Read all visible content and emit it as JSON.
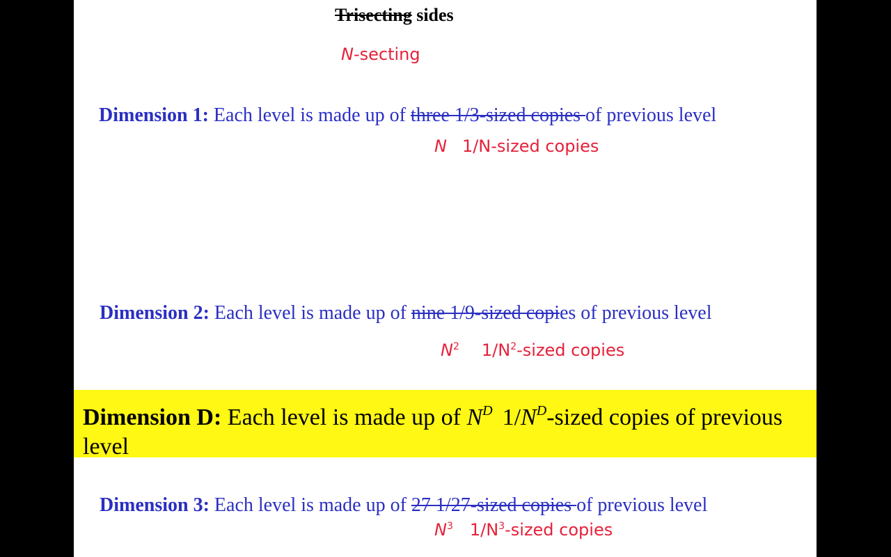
{
  "title": {
    "struck": "Trisecting",
    "rest": " sides"
  },
  "annotation_nsecting": {
    "n": "N",
    "rest": "-secting"
  },
  "dim1": {
    "label": "Dimension 1:",
    "lead": " Each level is made up of ",
    "struck": "three 1/3-sized copies ",
    "tail": "of previous level",
    "replacement_count": "N",
    "replacement_rest": "1/N-sized copies"
  },
  "dim2": {
    "label": "Dimension 2:",
    "lead": " Each level is made up of ",
    "struck": "nine 1/9-sized copi",
    "tail": "es of previous level",
    "replacement_count_base": "N",
    "replacement_count_exp": "2",
    "replacement_rest_a": "1/N",
    "replacement_rest_exp": "2",
    "replacement_rest_b": "-sized copies"
  },
  "dimD": {
    "label": "Dimension D:",
    "lead": " Each level is made up of ",
    "count_base": "N",
    "count_exp": "D",
    "frac_a": "1/",
    "frac_base": "N",
    "frac_exp": "D",
    "tail": "-sized copies of previous level",
    "highlight_color": "#fff714"
  },
  "dim3": {
    "label": "Dimension 3:",
    "lead": " Each level is made up of ",
    "struck": "27 1/27-sized copies ",
    "tail": "of previous level",
    "replacement_count_base": "N",
    "replacement_count_exp": "3",
    "replacement_rest_a": "1/N",
    "replacement_rest_exp": "3",
    "replacement_rest_b": "-sized copies"
  },
  "colors": {
    "text_blue": "#2b2fc2",
    "annotation_red": "#e5213a",
    "background": "#000000",
    "slide": "#ffffff"
  }
}
